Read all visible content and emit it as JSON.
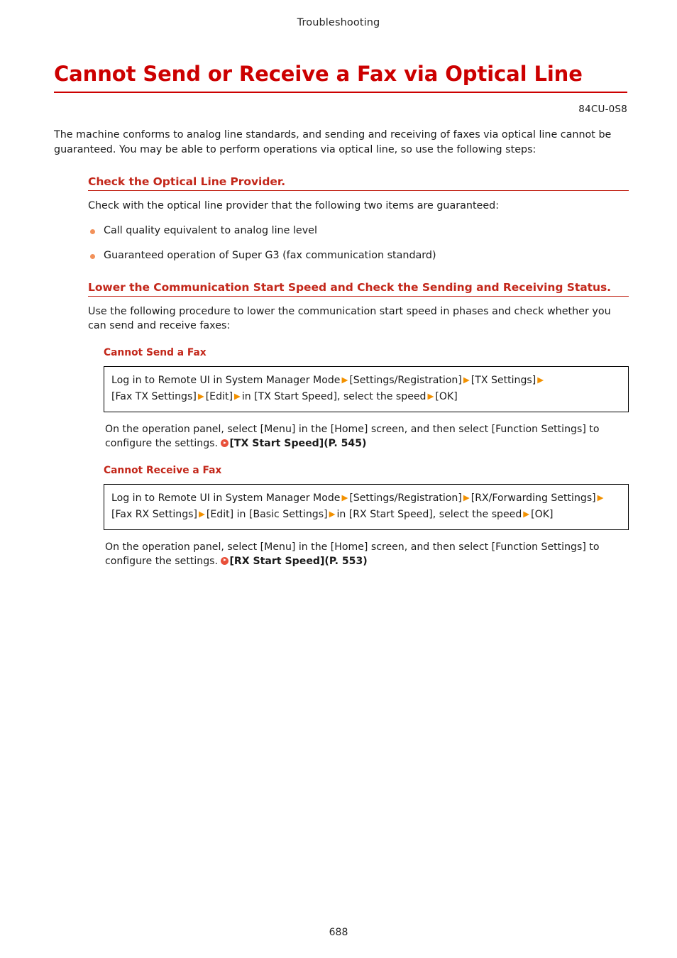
{
  "header": {
    "running_title": "Troubleshooting"
  },
  "title": "Cannot Send or Receive a Fax via Optical Line",
  "doc_code": "84CU-0S8",
  "intro": "The machine conforms to analog line standards, and sending and receiving of faxes via optical line cannot be guaranteed. You may be able to perform operations via optical line, so use the following steps:",
  "colors": {
    "title_red": "#cc0000",
    "heading_red": "#c3271a",
    "arrow_orange": "#f29100",
    "bullet_orange": "#f2915a",
    "xref_red": "#e8503a"
  },
  "sections": [
    {
      "heading": "Check the Optical Line Provider.",
      "body": "Check with the optical line provider that the following two items are guaranteed:",
      "bullets": [
        "Call quality equivalent to analog line level",
        "Guaranteed operation of Super G3 (fax communication standard)"
      ]
    },
    {
      "heading": "Lower the Communication Start Speed and Check the Sending and Receiving Status.",
      "body": "Use the following procedure to lower the communication start speed in phases and check whether you can send and receive faxes:",
      "subblocks": [
        {
          "heading": "Cannot Send a Fax",
          "procedure": [
            "Log in to Remote UI in System Manager Mode",
            "[Settings/Registration]",
            "[TX Settings]",
            "[Fax TX Settings]",
            "[Edit]",
            "in [TX Start Speed], select the speed",
            "[OK]"
          ],
          "note_text_1": "On the operation panel, select [Menu] in the [Home] screen, and then select [Function Settings] to configure the settings. ",
          "xref_label": "[TX Start Speed]",
          "xref_page": "(P. 545)"
        },
        {
          "heading": "Cannot Receive a Fax",
          "procedure": [
            "Log in to Remote UI in System Manager Mode",
            "[Settings/Registration]",
            "[RX/Forwarding Settings]",
            "[Fax RX Settings]",
            "[Edit] in [Basic Settings]",
            "in [RX Start Speed], select the speed",
            "[OK]"
          ],
          "note_text_1": "On the operation panel, select [Menu] in the [Home] screen, and then select [Function Settings] to configure the settings. ",
          "xref_label": "[RX Start Speed]",
          "xref_page": "(P. 553)"
        }
      ]
    }
  ],
  "page_number": "688"
}
